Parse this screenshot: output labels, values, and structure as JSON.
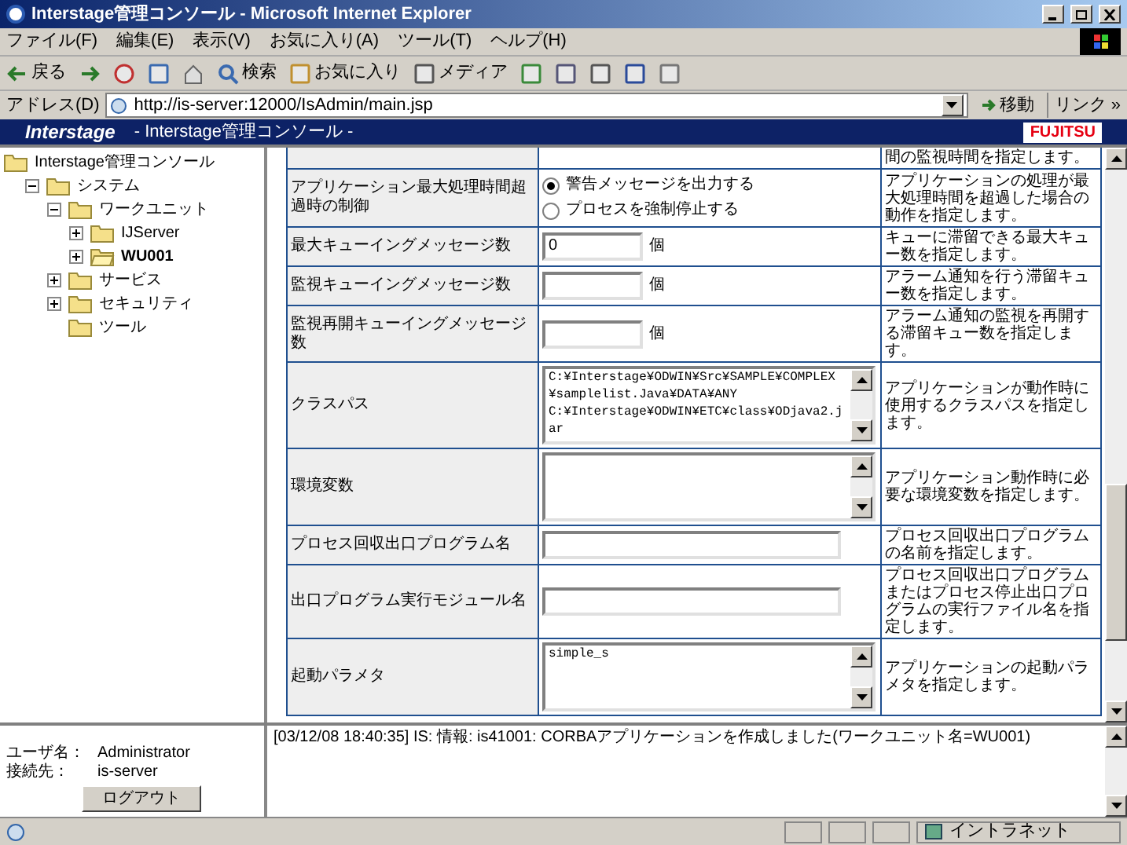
{
  "window": {
    "title": "Interstage管理コンソール - Microsoft Internet Explorer"
  },
  "menu": [
    "ファイル(F)",
    "編集(E)",
    "表示(V)",
    "お気に入り(A)",
    "ツール(T)",
    "ヘルプ(H)"
  ],
  "toolbar": [
    {
      "kind": "back",
      "label": "戻る"
    },
    {
      "kind": "forward"
    },
    {
      "kind": "stop"
    },
    {
      "kind": "refresh"
    },
    {
      "kind": "home"
    },
    {
      "kind": "search",
      "label": "検索"
    },
    {
      "kind": "favorites",
      "label": "お気に入り"
    },
    {
      "kind": "media",
      "label": "メディア"
    },
    {
      "kind": "history"
    },
    {
      "kind": "mail"
    },
    {
      "kind": "print"
    },
    {
      "kind": "edit"
    },
    {
      "kind": "discuss"
    }
  ],
  "address": {
    "label": "アドレス(D)",
    "value": "http://is-server:12000/IsAdmin/main.jsp",
    "go": "移動",
    "links": "リンク »"
  },
  "banner": {
    "logo": "Interstage",
    "title": "- Interstage管理コンソール -",
    "brand": "FUJITSU"
  },
  "tree": {
    "label": "Interstage管理コンソール",
    "children": [
      {
        "label": "システム",
        "expanded": true,
        "children": [
          {
            "label": "ワークユニット",
            "expanded": true,
            "children": [
              {
                "label": "IJServer",
                "expanded": false,
                "selected": false
              },
              {
                "label": "WU001",
                "expanded": false,
                "selected": true
              }
            ]
          },
          {
            "label": "サービス",
            "expanded": false
          },
          {
            "label": "セキュリティ",
            "expanded": false
          },
          {
            "label": "ツール"
          }
        ]
      }
    ]
  },
  "settings": [
    {
      "kind": "partial",
      "description": "間の監視時間を指定します。"
    },
    {
      "kind": "radio",
      "label": "アプリケーション最大処理時間超過時の制御",
      "options": [
        {
          "label": "警告メッセージを出力する",
          "selected": true
        },
        {
          "label": "プロセスを強制停止する",
          "selected": false
        }
      ],
      "description": "アプリケーションの処理が最大処理時間を超過した場合の動作を指定します。"
    },
    {
      "kind": "number",
      "label": "最大キューイングメッセージ数",
      "value": "0",
      "unit": "個",
      "description": "キューに滞留できる最大キュー数を指定します。"
    },
    {
      "kind": "number",
      "label": "監視キューイングメッセージ数",
      "unit": "個",
      "description": "アラーム通知を行う滞留キュー数を指定します。"
    },
    {
      "kind": "number",
      "label": "監視再開キューイングメッセージ数",
      "unit": "個",
      "description": "アラーム通知の監視を再開する滞留キュー数を指定します。"
    },
    {
      "kind": "textarea",
      "label": "クラスパス",
      "value": "C:¥Interstage¥ODWIN¥Src¥SAMPLE¥COMPLEX¥samplelist.Java¥DATA¥ANY\nC:¥Interstage¥ODWIN¥ETC¥class¥ODjava2.jar",
      "description": "アプリケーションが動作時に使用するクラスパスを指定します。"
    },
    {
      "kind": "textarea",
      "label": "環境変数",
      "description": "アプリケーション動作時に必要な環境変数を指定します。"
    },
    {
      "kind": "text",
      "label": "プロセス回収出口プログラム名",
      "description": "プロセス回収出口プログラムの名前を指定します。"
    },
    {
      "kind": "text",
      "label": "出口プログラム実行モジュール名",
      "description": "プロセス回収出口プログラムまたはプロセス停止出口プログラムの実行ファイル名を指定します。"
    },
    {
      "kind": "textarea",
      "label": "起動パラメタ",
      "value": "simple_s",
      "description": "アプリケーションの起動パラメタを指定します。"
    }
  ],
  "session": {
    "user_label": "ユーザ名：",
    "user": "Administrator",
    "host_label": "接続先：",
    "host": "is-server",
    "logout": "ログアウト"
  },
  "log": [
    "[03/12/08 18:40:35] IS: 情報: is41001: CORBAアプリケーションを作成しました(ワークユニット名=WU001)"
  ],
  "status_bar": {
    "zone": "イントラネット"
  }
}
